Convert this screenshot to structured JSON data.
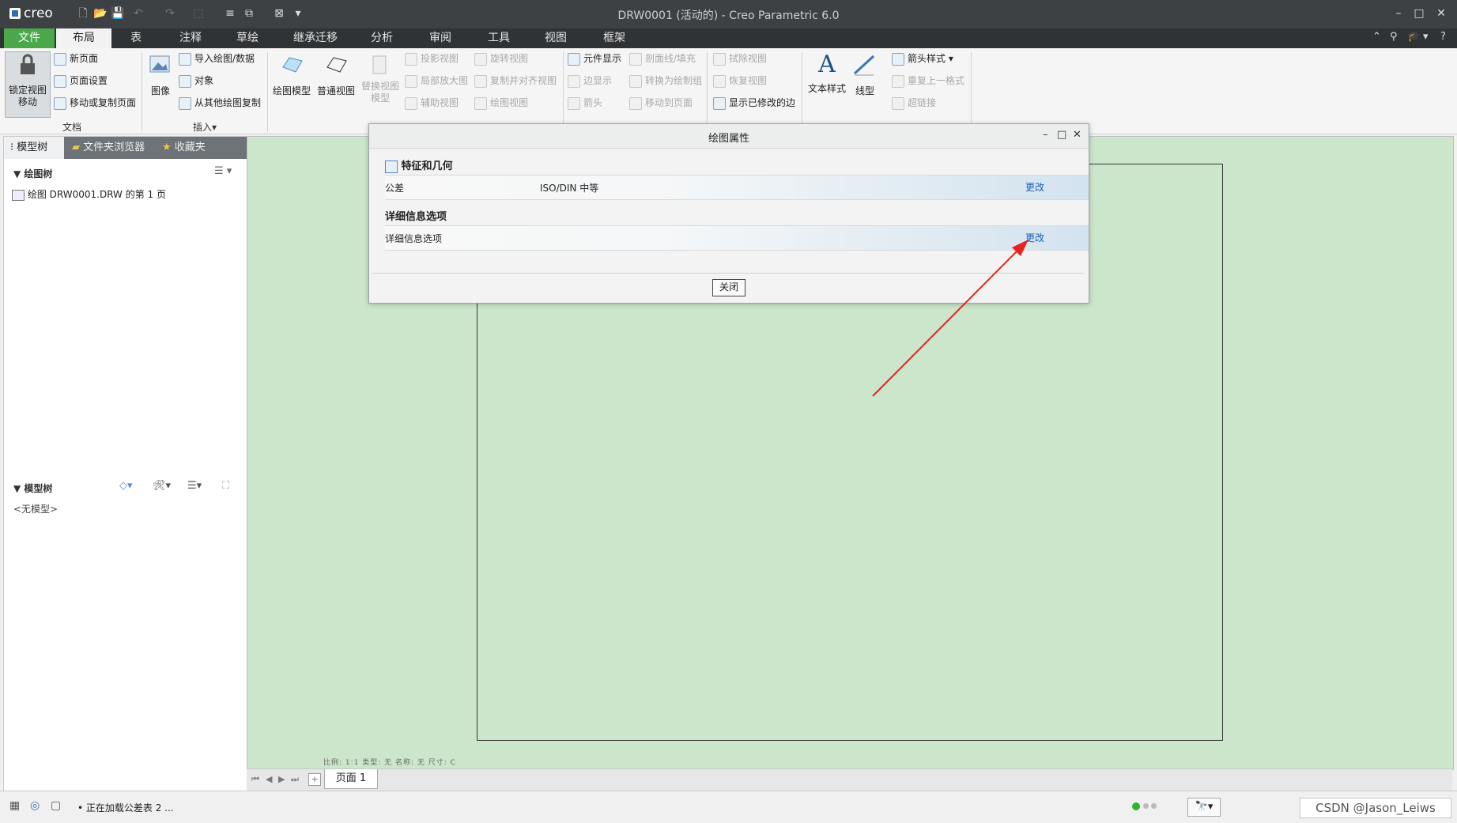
{
  "window": {
    "app_logo": "creo",
    "title": "DRW0001 (活动的) - Creo Parametric 6.0",
    "controls": {
      "minimize": "–",
      "maximize": "□",
      "close": "✕"
    }
  },
  "quick_access": [
    "new-icon",
    "open-icon",
    "save-icon",
    "undo-icon",
    "redo-icon",
    "select-box-icon",
    "regenerate-icon",
    "window-icon",
    "close-window-icon",
    "customize-icon"
  ],
  "tabs": [
    {
      "label": "文件"
    },
    {
      "label": "布局"
    },
    {
      "label": "表"
    },
    {
      "label": "注释"
    },
    {
      "label": "草绘"
    },
    {
      "label": "继承迁移"
    },
    {
      "label": "分析"
    },
    {
      "label": "审阅"
    },
    {
      "label": "工具"
    },
    {
      "label": "视图"
    },
    {
      "label": "框架"
    }
  ],
  "ribbon": {
    "document": {
      "lock_view": "锁定视图\n移动",
      "new_page": "新页面",
      "page_setup": "页面设置",
      "move_copy_page": "移动或复制页面",
      "group_label": "文档"
    },
    "insert": {
      "image": "图像",
      "import_drawing": "导入绘图/数据",
      "object": "对象",
      "copy_from_drawing": "从其他绘图复制",
      "group_label": "插入▾"
    },
    "model_views": {
      "drawing_model": "绘图模型",
      "general_view": "普通视图",
      "replace_view_model": "替换视图\n模型",
      "projection_view": "投影视图",
      "detailed_view": "局部放大图",
      "auxiliary_view": "辅助视图",
      "revolved_view": "旋转视图",
      "copy_align_view": "复制并对齐视图",
      "drawing_view": "绘图视图"
    },
    "edit": {
      "element_display": "元件显示",
      "edge_display": "边显示",
      "arrow": "箭头",
      "section_hatch": "剖面线/填充",
      "convert_draft": "转换为绘制组",
      "move_to_page": "移动到页面"
    },
    "display": {
      "erase_view": "拭除视图",
      "resume_view": "恢复视图",
      "show_modified_edges": "显示已修改的边"
    },
    "format": {
      "text_style": "文本样式",
      "line_style": "线型",
      "arrow_style": "箭头样式",
      "repeat_format": "重复上一格式",
      "hyperlink": "超链接"
    }
  },
  "left_panel": {
    "tabs": [
      "模型树",
      "文件夹浏览器",
      "收藏夹"
    ],
    "drawing_tree_label": "绘图树",
    "drawing_tree_item": "绘图 DRW0001.DRW 的第 1 页",
    "model_tree_label": "模型树",
    "model_tree_empty": "<无模型>"
  },
  "canvas": {
    "sheet_meta": "比例: 1:1   类型: 无   名称: 无   尺寸: C",
    "page_tab": "页面 1"
  },
  "status": {
    "message": "正在加载公差表 2 ...",
    "watermark": "CSDN @Jason_Leiws",
    "indicator_color": "#2db52d"
  },
  "dialog": {
    "title": "绘图属性",
    "section1": "特征和几何",
    "row1_key": "公差",
    "row1_value": "ISO/DIN 中等",
    "row1_link": "更改",
    "section2": "详细信息选项",
    "row2_key": "详细信息选项",
    "row2_link": "更改",
    "close_button": "关闭"
  },
  "annotation": {
    "arrow_color": "#e8231c"
  }
}
